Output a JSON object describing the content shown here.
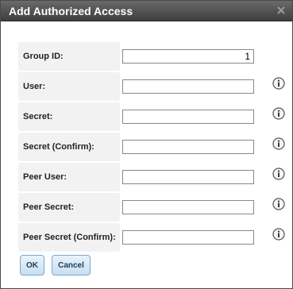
{
  "dialog": {
    "title": "Add Authorized Access",
    "close_icon": "close-x-icon"
  },
  "form": {
    "fields": [
      {
        "label": "Group ID:",
        "value": "1",
        "info": false
      },
      {
        "label": "User:",
        "value": "",
        "info": true
      },
      {
        "label": "Secret:",
        "value": "",
        "info": true
      },
      {
        "label": "Secret (Confirm):",
        "value": "",
        "info": true
      },
      {
        "label": "Peer User:",
        "value": "",
        "info": true
      },
      {
        "label": "Peer Secret:",
        "value": "",
        "info": true
      },
      {
        "label": "Peer Secret (Confirm):",
        "value": "",
        "info": true
      }
    ],
    "info_icon": "info-circle-icon"
  },
  "buttons": {
    "ok_label": "OK",
    "cancel_label": "Cancel"
  },
  "colors": {
    "titlebar": "#4f4f4f",
    "label_bg": "#f2f2f2",
    "button_border": "#7fa6c8"
  }
}
